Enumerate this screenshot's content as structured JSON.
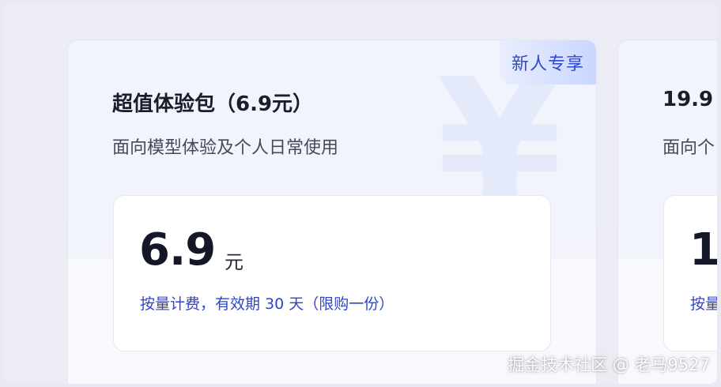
{
  "cards": [
    {
      "badge": "新人专享",
      "bg_symbol": "¥",
      "title": "超值体验包（6.9元）",
      "subtitle": "面向模型体验及个人日常使用",
      "price": "6.9",
      "unit": "元",
      "note": "按量计费，有效期 30 天（限购一份）"
    },
    {
      "title": "19.9",
      "subtitle": "面向个",
      "price": "1",
      "note": "按量"
    }
  ],
  "watermark": "掘金技术社区 @ 老马9527",
  "colors": {
    "accent": "#2f45c8",
    "background": "#ebecf4",
    "badge_gradient_end": "#c9d6ff"
  }
}
